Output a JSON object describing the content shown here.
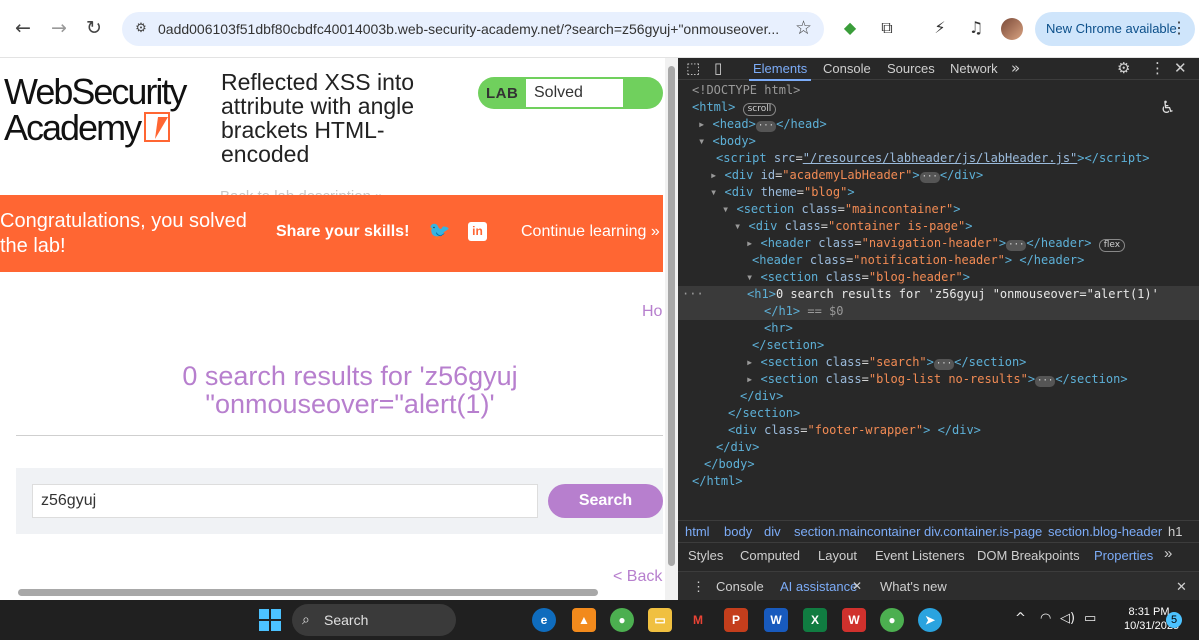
{
  "browser": {
    "url": "0add006103f51dbf80cbdfc40014003b.web-security-academy.net/?search=z56gyuj+\"onmouseover...",
    "new_chrome_label": "New Chrome available"
  },
  "page": {
    "logo_line1": "WebSecurity",
    "logo_line2": "Academy",
    "lab_title": "Reflected XSS into attribute with angle brackets HTML-encoded",
    "back_link": "Back to lab description",
    "badge_lab": "LAB",
    "badge_status": "Solved",
    "congrats": "Congratulations, you solved the lab!",
    "share": "Share your skills!",
    "continue": "Continue learning",
    "home_link": "Ho",
    "results_heading": "0 search results for 'z56gyuj \"onmouseover=\"alert(1)'",
    "search_value": "z56gyuj",
    "search_button": "Search",
    "back_bottom": "< Back"
  },
  "devtools": {
    "tabs": [
      "Elements",
      "Console",
      "Sources",
      "Network"
    ],
    "breadcrumbs": [
      "html",
      "body",
      "div",
      "section.maincontainer",
      "div.container.is-page",
      "section.blog-header",
      "h1"
    ],
    "subtabs": [
      "Styles",
      "Computed",
      "Layout",
      "Event Listeners",
      "DOM Breakpoints",
      "Properties"
    ],
    "drawer": [
      "Console",
      "AI assistance",
      "What's new"
    ]
  },
  "taskbar": {
    "search_label": "Search",
    "time": "8:31 PM",
    "date": "10/31/2025",
    "notification_count": "5"
  }
}
